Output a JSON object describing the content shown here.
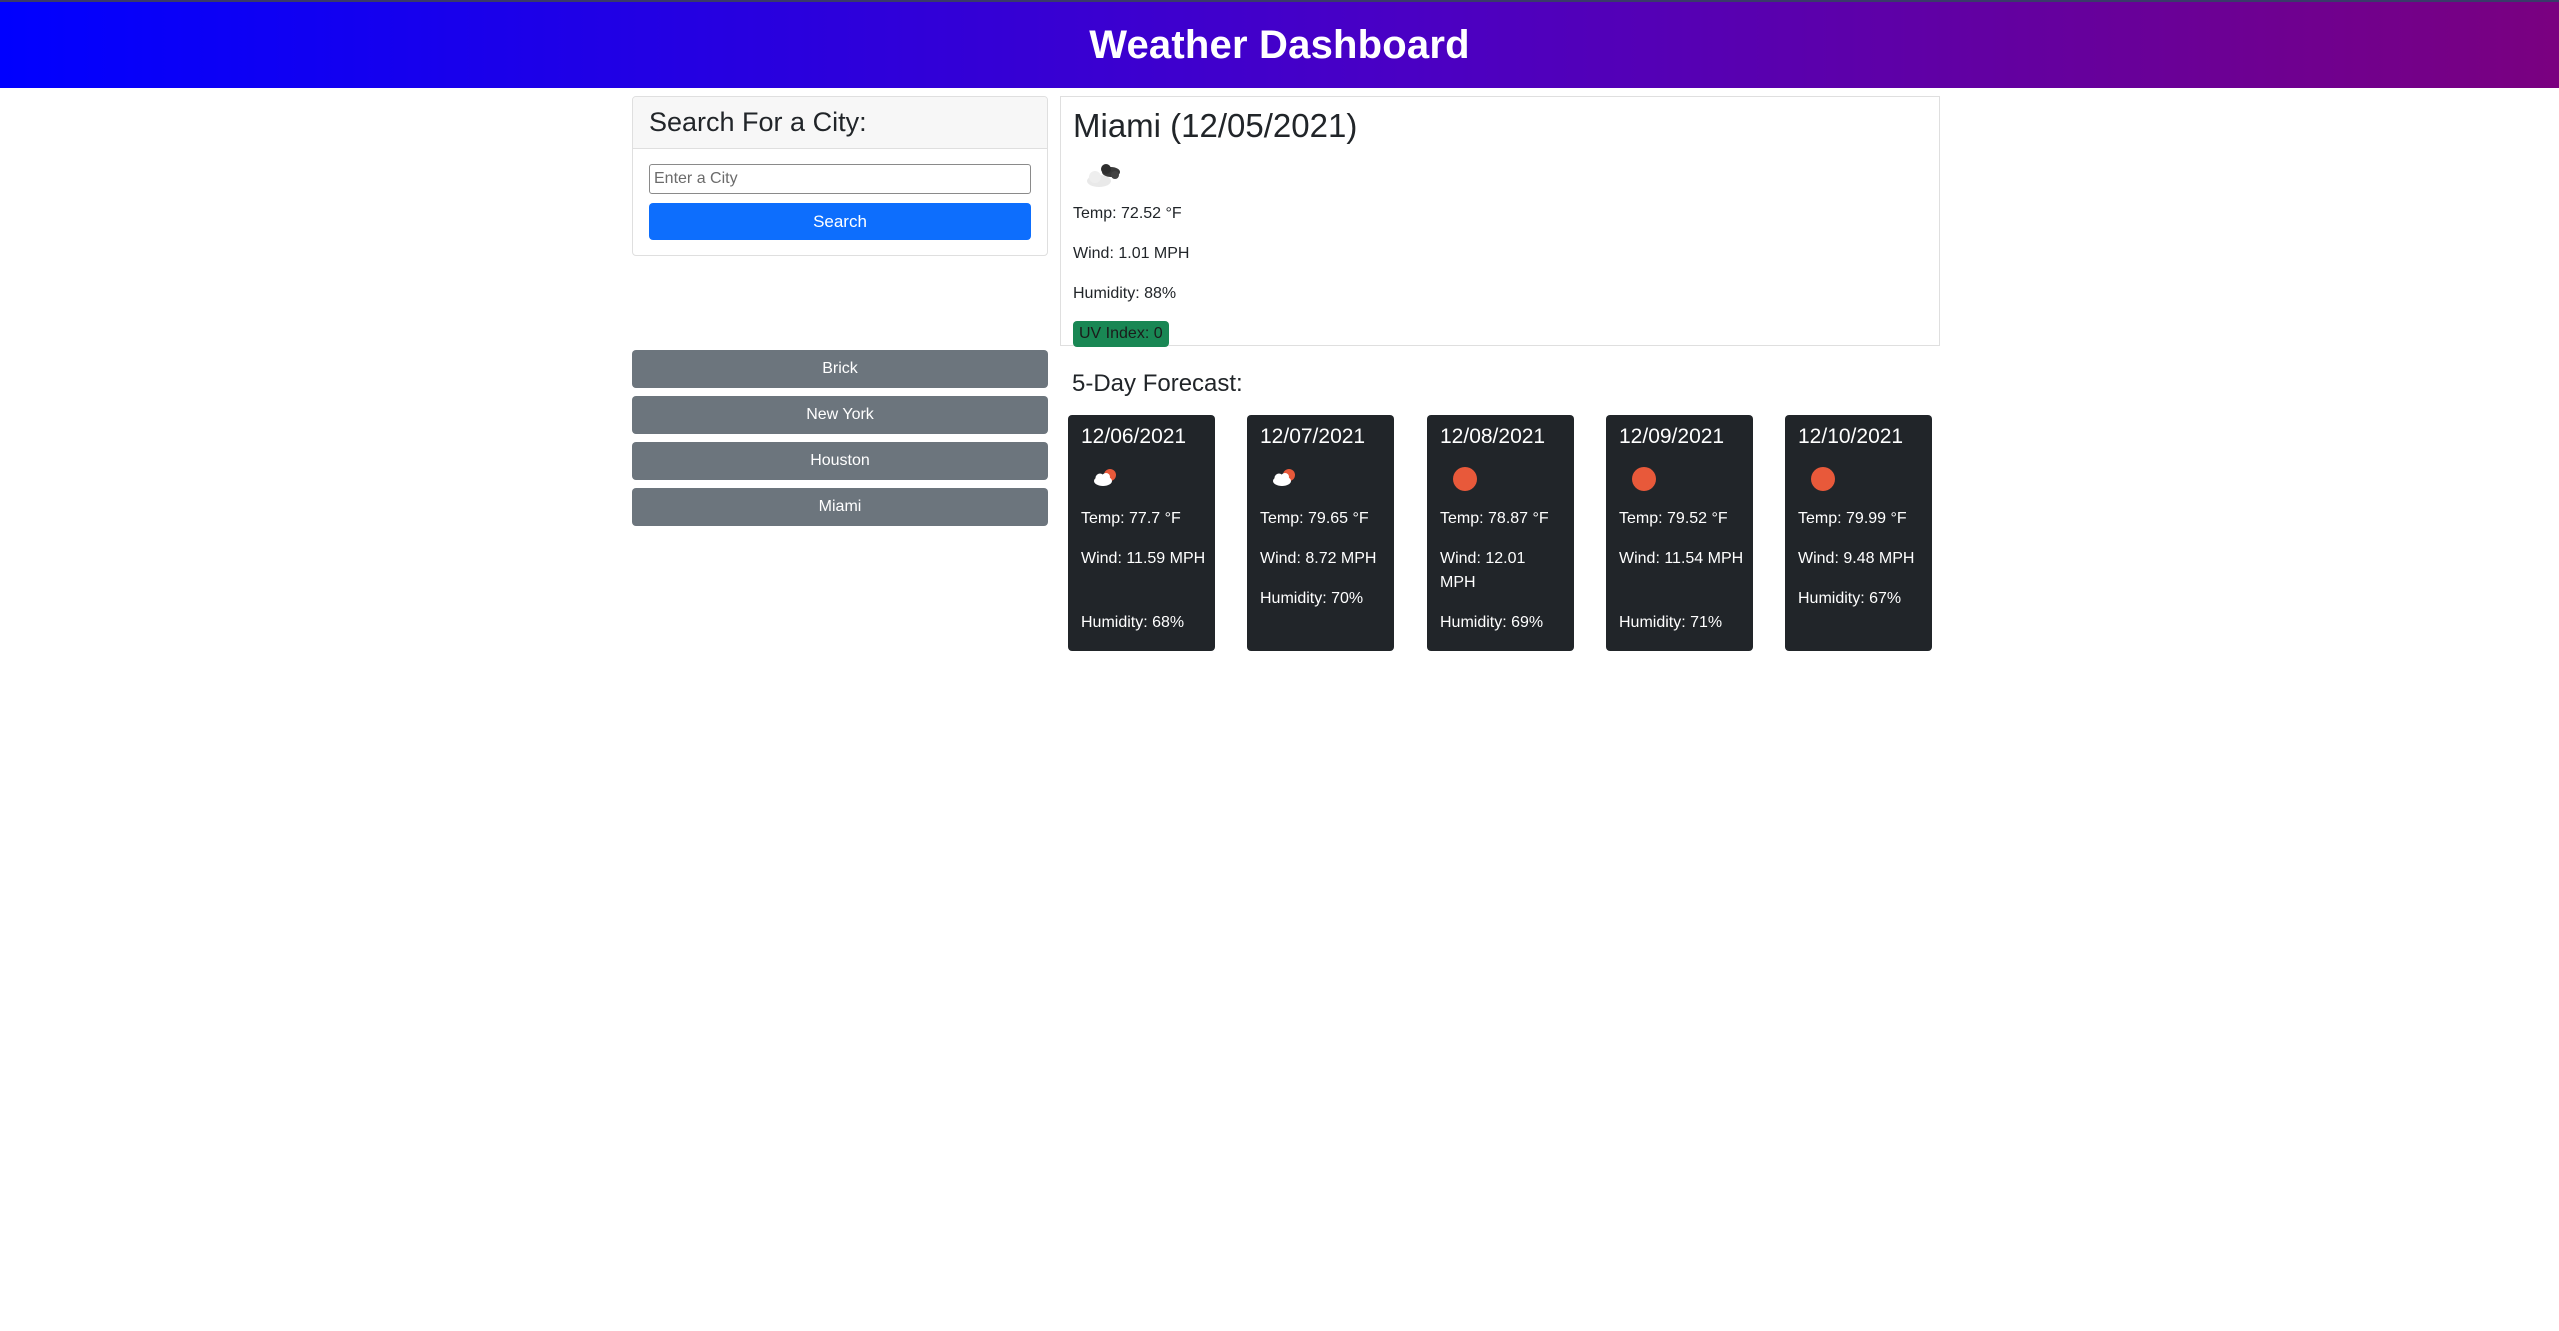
{
  "header": {
    "title": "Weather Dashboard"
  },
  "search": {
    "heading": "Search For a City:",
    "placeholder": "Enter a City",
    "button_label": "Search"
  },
  "history": [
    "Brick",
    "New York",
    "Houston",
    "Miami"
  ],
  "current": {
    "title": "Miami (12/05/2021)",
    "icon": "dark-clouds-icon",
    "temp": "Temp: 72.52 °F",
    "wind": "Wind: 1.01 MPH",
    "humidity": "Humidity: 88%",
    "uv": "UV Index: 0"
  },
  "forecast_title": "5-Day Forecast:",
  "forecast": [
    {
      "date": "12/06/2021",
      "icon": "partly-cloudy-icon",
      "temp": "Temp: 77.7 °F",
      "wind": "Wind: 11.59 MPH",
      "humidity": "Humidity: 68%"
    },
    {
      "date": "12/07/2021",
      "icon": "partly-cloudy-icon",
      "temp": "Temp: 79.65 °F",
      "wind": "Wind: 8.72 MPH",
      "humidity": "Humidity: 70%"
    },
    {
      "date": "12/08/2021",
      "icon": "sun-icon",
      "temp": "Temp: 78.87 °F",
      "wind": "Wind: 12.01 MPH",
      "humidity": "Humidity: 69%"
    },
    {
      "date": "12/09/2021",
      "icon": "sun-icon",
      "temp": "Temp: 79.52 °F",
      "wind": "Wind: 11.54 MPH",
      "humidity": "Humidity: 71%"
    },
    {
      "date": "12/10/2021",
      "icon": "sun-icon",
      "temp": "Temp: 79.99 °F",
      "wind": "Wind: 9.48 MPH",
      "humidity": "Humidity: 67%"
    }
  ],
  "colors": {
    "header_gradient_start": "#0000ff",
    "header_gradient_end": "#7a0080",
    "search_button": "#0d6efd",
    "history_button": "#6c757d",
    "forecast_card": "#212529",
    "uv_badge": "#198754",
    "sun": "#e8593a"
  }
}
